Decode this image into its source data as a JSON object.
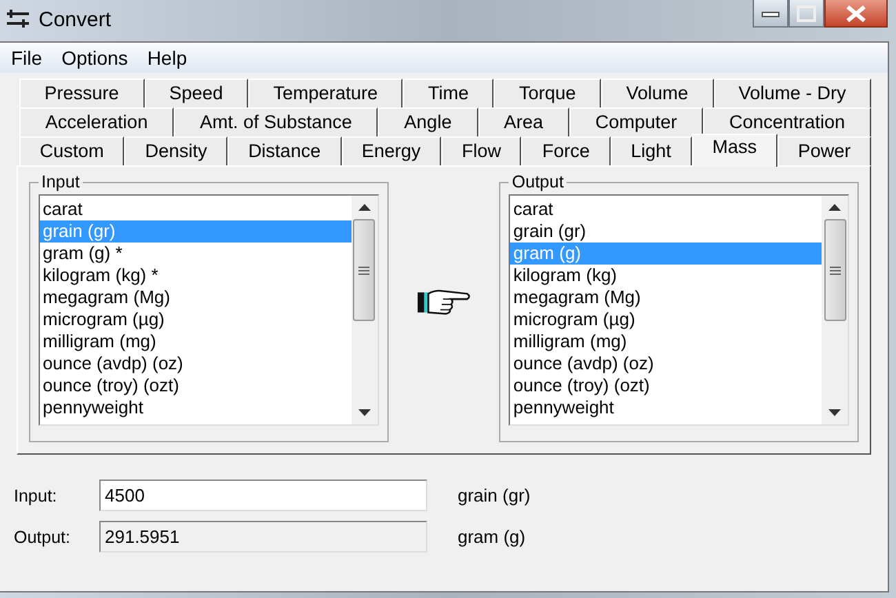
{
  "window": {
    "title": "Convert"
  },
  "menu": [
    "File",
    "Options",
    "Help"
  ],
  "tab_rows": [
    [
      {
        "label": "Pressure",
        "selected": false
      },
      {
        "label": "Speed",
        "selected": false
      },
      {
        "label": "Temperature",
        "selected": false
      },
      {
        "label": "Time",
        "selected": false
      },
      {
        "label": "Torque",
        "selected": false
      },
      {
        "label": "Volume",
        "selected": false
      },
      {
        "label": "Volume - Dry",
        "selected": false
      }
    ],
    [
      {
        "label": "Acceleration",
        "selected": false
      },
      {
        "label": "Amt. of Substance",
        "selected": false
      },
      {
        "label": "Angle",
        "selected": false
      },
      {
        "label": "Area",
        "selected": false
      },
      {
        "label": "Computer",
        "selected": false
      },
      {
        "label": "Concentration",
        "selected": false
      }
    ],
    [
      {
        "label": "Custom",
        "selected": false
      },
      {
        "label": "Density",
        "selected": false
      },
      {
        "label": "Distance",
        "selected": false
      },
      {
        "label": "Energy",
        "selected": false
      },
      {
        "label": "Flow",
        "selected": false
      },
      {
        "label": "Force",
        "selected": false
      },
      {
        "label": "Light",
        "selected": false
      },
      {
        "label": "Mass",
        "selected": true
      },
      {
        "label": "Power",
        "selected": false
      }
    ]
  ],
  "input_group": {
    "title": "Input",
    "items": [
      {
        "label": "carat",
        "selected": false
      },
      {
        "label": "grain (gr)",
        "selected": true
      },
      {
        "label": "gram (g) *",
        "selected": false
      },
      {
        "label": "kilogram (kg) *",
        "selected": false
      },
      {
        "label": "megagram (Mg)",
        "selected": false
      },
      {
        "label": "microgram (µg)",
        "selected": false
      },
      {
        "label": "milligram (mg)",
        "selected": false
      },
      {
        "label": "ounce (avdp) (oz)",
        "selected": false
      },
      {
        "label": "ounce (troy) (ozt)",
        "selected": false
      },
      {
        "label": "pennyweight",
        "selected": false
      }
    ]
  },
  "output_group": {
    "title": "Output",
    "items": [
      {
        "label": "carat",
        "selected": false
      },
      {
        "label": "grain (gr)",
        "selected": false
      },
      {
        "label": "gram (g)",
        "selected": true
      },
      {
        "label": "kilogram (kg)",
        "selected": false
      },
      {
        "label": "megagram (Mg)",
        "selected": false
      },
      {
        "label": "microgram (µg)",
        "selected": false
      },
      {
        "label": "milligram (mg)",
        "selected": false
      },
      {
        "label": "ounce (avdp) (oz)",
        "selected": false
      },
      {
        "label": "ounce (troy) (ozt)",
        "selected": false
      },
      {
        "label": "pennyweight",
        "selected": false
      }
    ]
  },
  "input_row": {
    "label": "Input:",
    "value": "4500",
    "unit": "grain (gr)"
  },
  "output_row": {
    "label": "Output:",
    "value": "291.5951",
    "unit": "gram (g)"
  }
}
